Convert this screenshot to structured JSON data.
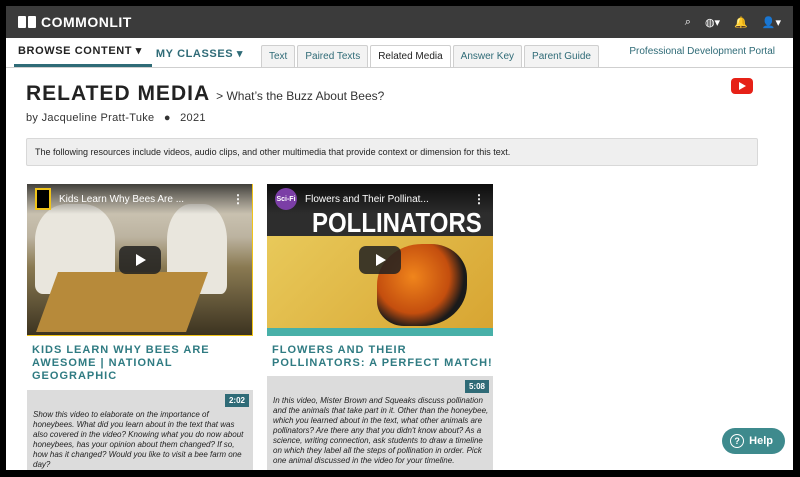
{
  "app": {
    "logo_bold": "COMMON",
    "logo_light": "LIT"
  },
  "top_icons": {
    "search": "⌕",
    "globe": "◍▾",
    "bell": "🔔",
    "user": "👤▾"
  },
  "nav": {
    "browse": "BROWSE CONTENT ▾",
    "classes": "MY CLASSES ▾",
    "tabs": [
      "Text",
      "Paired Texts",
      "Related Media",
      "Answer Key",
      "Parent Guide"
    ],
    "pdp": "Professional Development Portal"
  },
  "header": {
    "title": "RELATED MEDIA",
    "subtitle": "> What’s the Buzz About Bees?",
    "author": "by Jacqueline Pratt-Tuke",
    "dot": "●",
    "year": "2021"
  },
  "notice": "The following resources include videos, audio clips, and other multimedia that provide context or dimension for this text.",
  "cards": [
    {
      "video_title": "Kids Learn Why Bees Are ...",
      "title": "KIDS LEARN WHY BEES ARE AWESOME | NATIONAL GEOGRAPHIC",
      "duration": "2:02",
      "description": "Show this video to elaborate on the importance of honeybees. What did you learn about in the text that was also covered in the video? Knowing what you do now about honeybees, has your opinion about them changed? If so, how has it changed? Would you like to visit a bee farm one day?"
    },
    {
      "video_title": "Flowers and Their Pollinat...",
      "overlay": "POLLINATORS",
      "channel": "Sci-Fi",
      "title": "FLOWERS AND THEIR POLLINATORS: A PERFECT MATCH!",
      "duration": "5:08",
      "description": "In this video, Mister Brown and Squeaks discuss pollination and the animals that take part in it. Other than the honeybee, which you learned about in the text, what other animals are pollinators? Are there any that you didn't know about? As a science, writing connection, ask students to draw a timeline on which they label all the steps of pollination in order. Pick one animal discussed in the video for your timeline."
    }
  ],
  "help": {
    "icon": "?",
    "label": "Help"
  },
  "colors": {
    "accent": "#2f6b77",
    "topbar": "#3b3b3b",
    "youtube": "#e62117"
  }
}
